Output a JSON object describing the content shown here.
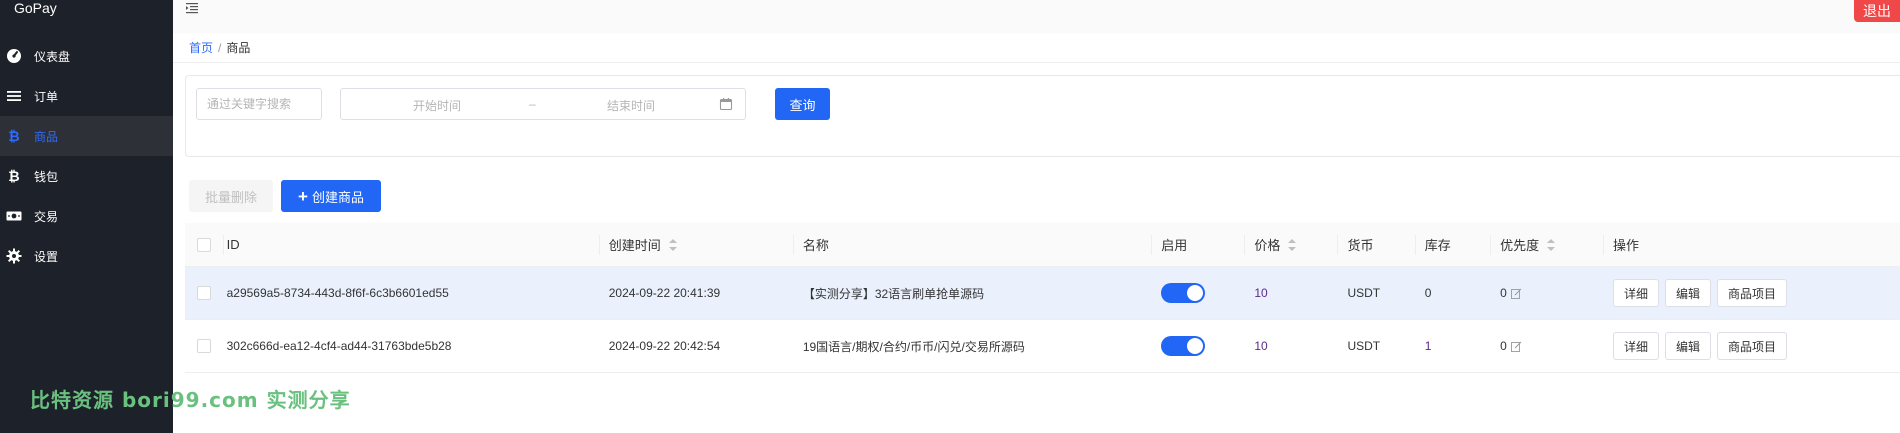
{
  "brand": "GoPay",
  "sidebar": {
    "items": [
      {
        "label": "仪表盘",
        "icon": "dashboard-icon"
      },
      {
        "label": "订单",
        "icon": "list-icon"
      },
      {
        "label": "商品",
        "icon": "bitcoin-icon",
        "active": true
      },
      {
        "label": "钱包",
        "icon": "bitcoin-icon"
      },
      {
        "label": "交易",
        "icon": "money-icon"
      },
      {
        "label": "设置",
        "icon": "gear-icon"
      }
    ]
  },
  "topbar": {
    "logout": "退出"
  },
  "breadcrumb": {
    "home": "首页",
    "sep": "/",
    "current": "商品"
  },
  "search": {
    "keyword_placeholder": "通过关键字搜索",
    "start_placeholder": "开始时间",
    "range_sep": "–",
    "end_placeholder": "结束时间",
    "query_label": "查询"
  },
  "toolbar": {
    "bulk_delete": "批量删除",
    "create": "创建商品"
  },
  "table": {
    "headers": {
      "id": "ID",
      "created": "创建时间",
      "name": "名称",
      "enabled": "启用",
      "price": "价格",
      "currency": "货币",
      "stock": "库存",
      "priority": "优先度",
      "actions": "操作"
    },
    "rows": [
      {
        "id": "a29569a5-8734-443d-8f6f-6c3b6601ed55",
        "created": "2024-09-22 20:41:39",
        "name": "【实测分享】32语言刷单抢单源码",
        "enabled": true,
        "price": "10",
        "currency": "USDT",
        "stock": "0",
        "priority": "0"
      },
      {
        "id": "302c666d-ea12-4cf4-ad44-31763bde5b28",
        "created": "2024-09-22 20:42:54",
        "name": "19国语言/期权/合约/币币/闪兑/交易所源码",
        "enabled": true,
        "price": "10",
        "currency": "USDT",
        "stock": "1",
        "priority": "0"
      }
    ],
    "actions": {
      "detail": "详细",
      "edit": "编辑",
      "items": "商品项目"
    }
  },
  "watermark": "比特资源 bori99.com 实测分享",
  "colors": {
    "primary": "#2166f5",
    "danger": "#f04848",
    "sidebar": "#1d2129"
  }
}
